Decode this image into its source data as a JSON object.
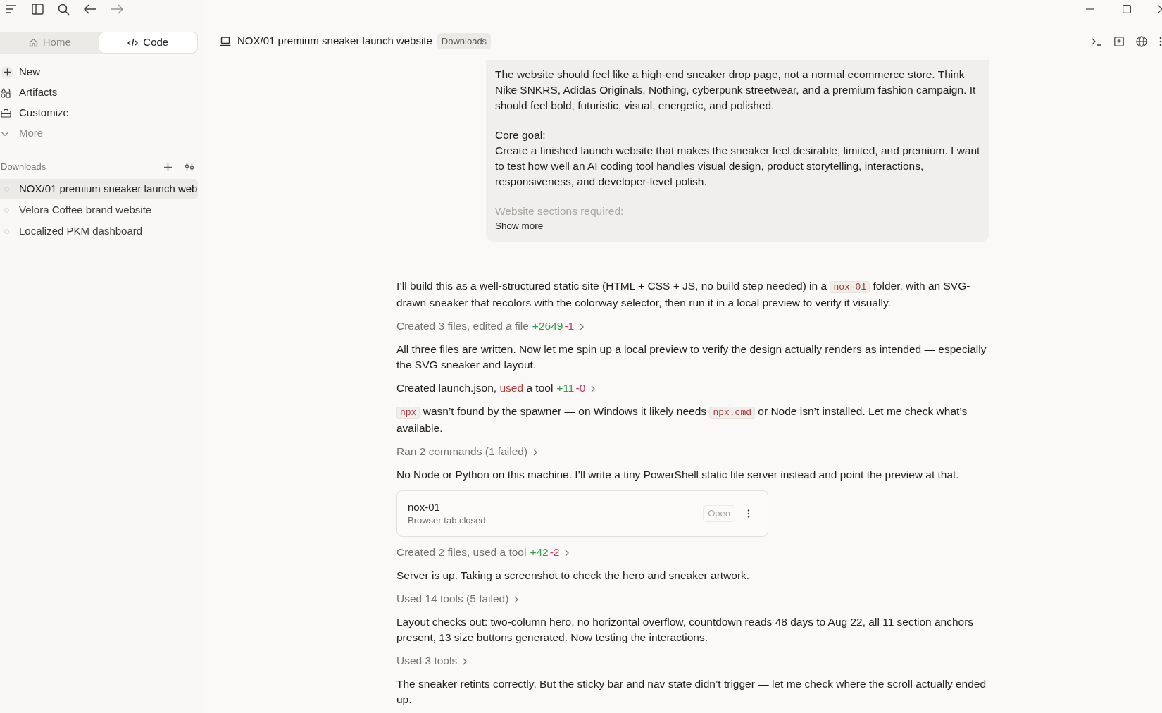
{
  "mode_tabs": [
    {
      "label": "Home",
      "selected": false
    },
    {
      "label": "Code",
      "selected": true
    }
  ],
  "nav": [
    {
      "label": "New",
      "kind": "new"
    },
    {
      "label": "Artifacts",
      "kind": "artifacts"
    },
    {
      "label": "Customize",
      "kind": "customize"
    },
    {
      "label": "More",
      "kind": "more"
    }
  ],
  "section": {
    "title": "Downloads"
  },
  "projects": [
    {
      "label": "NOX/01 premium sneaker launch web",
      "selected": true
    },
    {
      "label": "Velora Coffee brand website",
      "selected": false
    },
    {
      "label": "Localized PKM dashboard",
      "selected": false
    }
  ],
  "header": {
    "title": "NOX/01 premium sneaker launch website",
    "badge": "Downloads"
  },
  "user_message": {
    "paragraphs": [
      "The website should feel like a high-end sneaker drop page, not a normal ecommerce store. Think Nike SNKRS, Adidas Originals, Nothing, cyberpunk streetwear, and a premium fashion campaign. It should feel bold, futuristic, visual, energetic, and polished.",
      "Core goal:\nCreate a finished launch website that makes the sneaker feel desirable, limited, and premium. I want to test how well an AI coding tool handles visual design, product storytelling, interactions, responsiveness, and developer-level polish."
    ],
    "faded": "Website sections required:",
    "show_more": "Show more"
  },
  "transcript": [
    {
      "kind": "text",
      "segments": [
        {
          "kind": "plain",
          "text": "I’ll build this as a well-structured static site (HTML + CSS + JS, no build step needed) in a "
        },
        {
          "kind": "code",
          "text": "nox-01"
        },
        {
          "kind": "plain",
          "text": " folder, with an SVG-drawn sneaker that recolors with the colorway selector, then run it in a local preview to verify it visually."
        }
      ]
    },
    {
      "kind": "activity",
      "muted": true,
      "segments": [
        {
          "kind": "plain",
          "text": "Created 3 files, edited a file"
        }
      ],
      "added": "+2649",
      "removed": "-1"
    },
    {
      "kind": "text",
      "segments": [
        {
          "kind": "plain",
          "text": "All three files are written. Now let me spin up a local preview to verify the design actually renders as intended — especially the SVG sneaker and layout."
        }
      ]
    },
    {
      "kind": "activity",
      "muted": false,
      "segments": [
        {
          "kind": "plain",
          "text": "Created launch.json, "
        },
        {
          "kind": "mark",
          "text": "used"
        },
        {
          "kind": "plain",
          "text": " a tool"
        }
      ],
      "added": "+11",
      "removed": "-0"
    },
    {
      "kind": "text",
      "segments": [
        {
          "kind": "code",
          "text": "npx"
        },
        {
          "kind": "plain",
          "text": " wasn’t found by the spawner — on Windows it likely needs "
        },
        {
          "kind": "code",
          "text": "npx.cmd"
        },
        {
          "kind": "plain",
          "text": " or Node isn’t installed. Let me check what’s available."
        }
      ]
    },
    {
      "kind": "activity",
      "muted": true,
      "segments": [
        {
          "kind": "plain",
          "text": "Ran 2 commands (1 failed)"
        }
      ]
    },
    {
      "kind": "text",
      "segments": [
        {
          "kind": "plain",
          "text": "No Node or Python on this machine. I’ll write a tiny PowerShell static file server instead and point the preview at that."
        }
      ]
    },
    {
      "kind": "preview_card",
      "title": "nox-01",
      "subtitle": "Browser tab closed",
      "button": "Open"
    },
    {
      "kind": "activity",
      "muted": true,
      "segments": [
        {
          "kind": "plain",
          "text": "Created 2 files, used a tool"
        }
      ],
      "added": "+42",
      "removed": "-2"
    },
    {
      "kind": "text",
      "segments": [
        {
          "kind": "plain",
          "text": "Server is up. Taking a screenshot to check the hero and sneaker artwork."
        }
      ]
    },
    {
      "kind": "activity",
      "muted": true,
      "segments": [
        {
          "kind": "plain",
          "text": "Used 14 tools (5 failed)"
        }
      ]
    },
    {
      "kind": "text",
      "segments": [
        {
          "kind": "plain",
          "text": "Layout checks out: two-column hero, no horizontal overflow, countdown reads 48 days to Aug 22, all 11 section anchors present, 13 size buttons generated. Now testing the interactions."
        }
      ]
    },
    {
      "kind": "activity",
      "muted": true,
      "segments": [
        {
          "kind": "plain",
          "text": "Used 3 tools"
        }
      ]
    },
    {
      "kind": "text",
      "segments": [
        {
          "kind": "plain",
          "text": "The sneaker retints correctly. But the sticky bar and nav state didn’t trigger — let me check where the scroll actually ended up."
        }
      ]
    }
  ]
}
